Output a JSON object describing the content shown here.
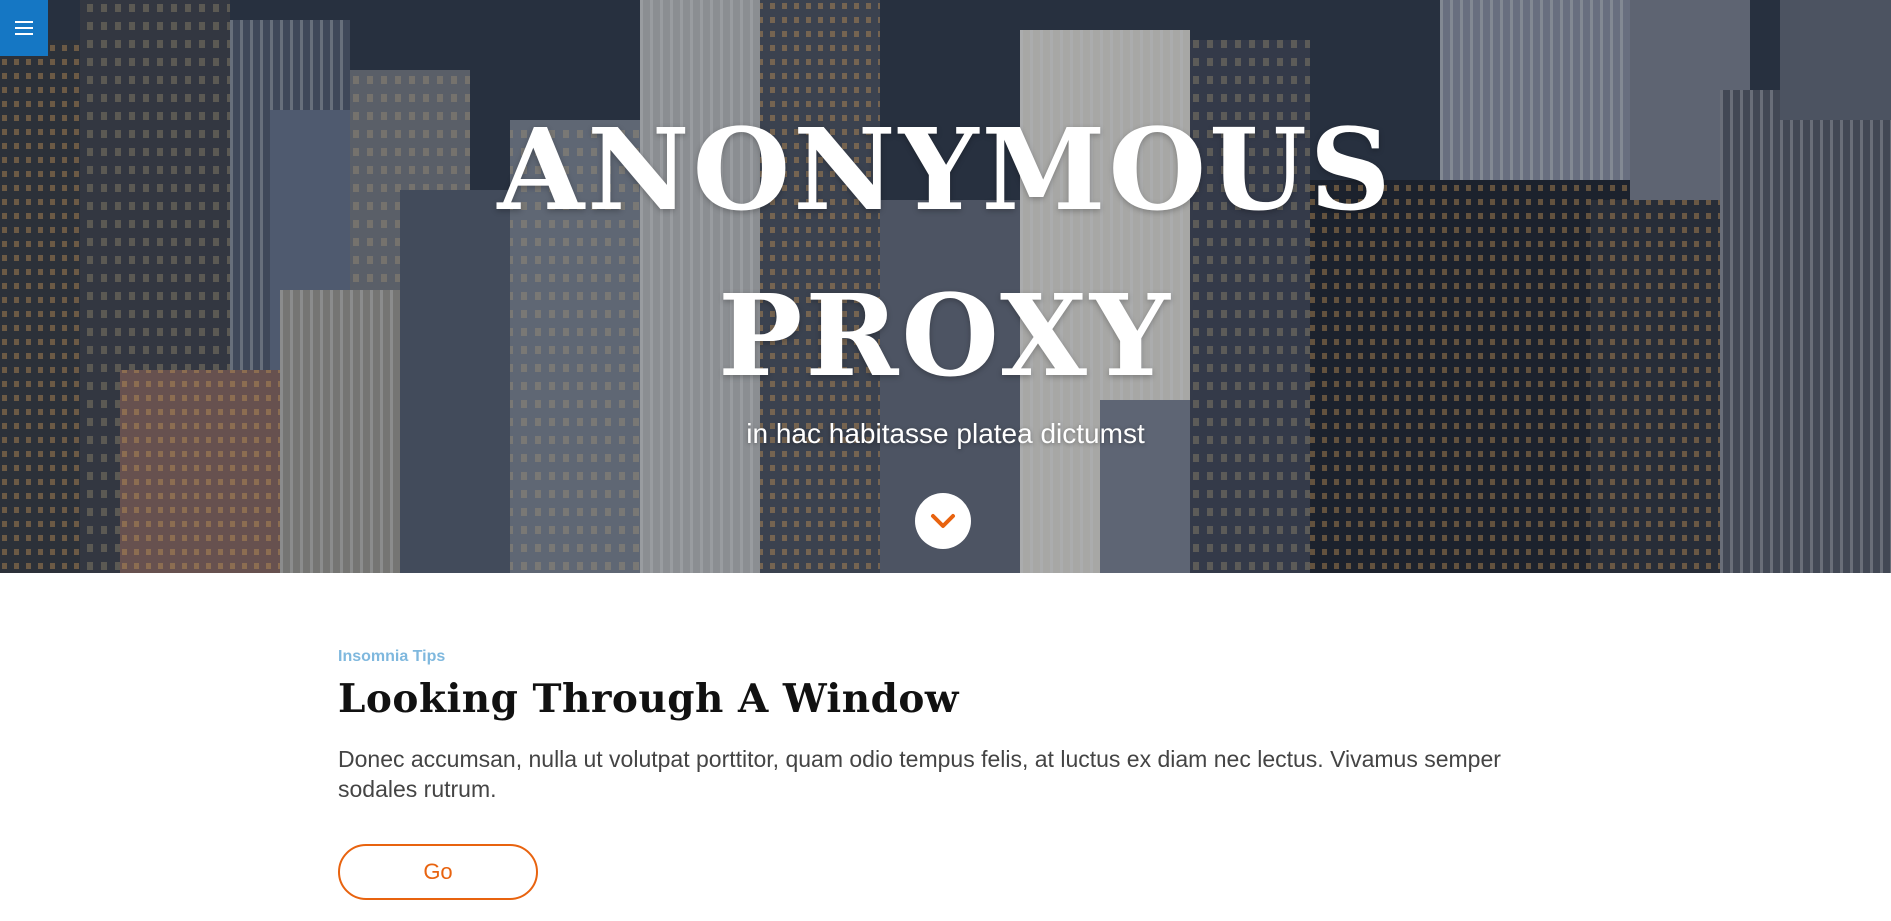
{
  "hero": {
    "title_line1": "ANONYMOUS",
    "title_line2": "PROXY",
    "subtitle": "in hac habitasse platea dictumst",
    "background": "city-skyline-photo"
  },
  "nav": {
    "menu_icon": "hamburger-icon",
    "menu_color": "#1577c4"
  },
  "scroll": {
    "icon": "chevron-down-icon",
    "accent": "#e8630f"
  },
  "article": {
    "category": "Insomnia Tips",
    "title": "Looking Through A Window",
    "body": "Donec accumsan, nulla ut volutpat porttitor, quam odio tempus felis, at luctus ex diam nec lectus. Vivamus semper sodales rutrum.",
    "button_label": "Go"
  },
  "colors": {
    "accent": "#e8630f",
    "category": "#7fb8de",
    "title": "#111111",
    "body": "#444444"
  }
}
